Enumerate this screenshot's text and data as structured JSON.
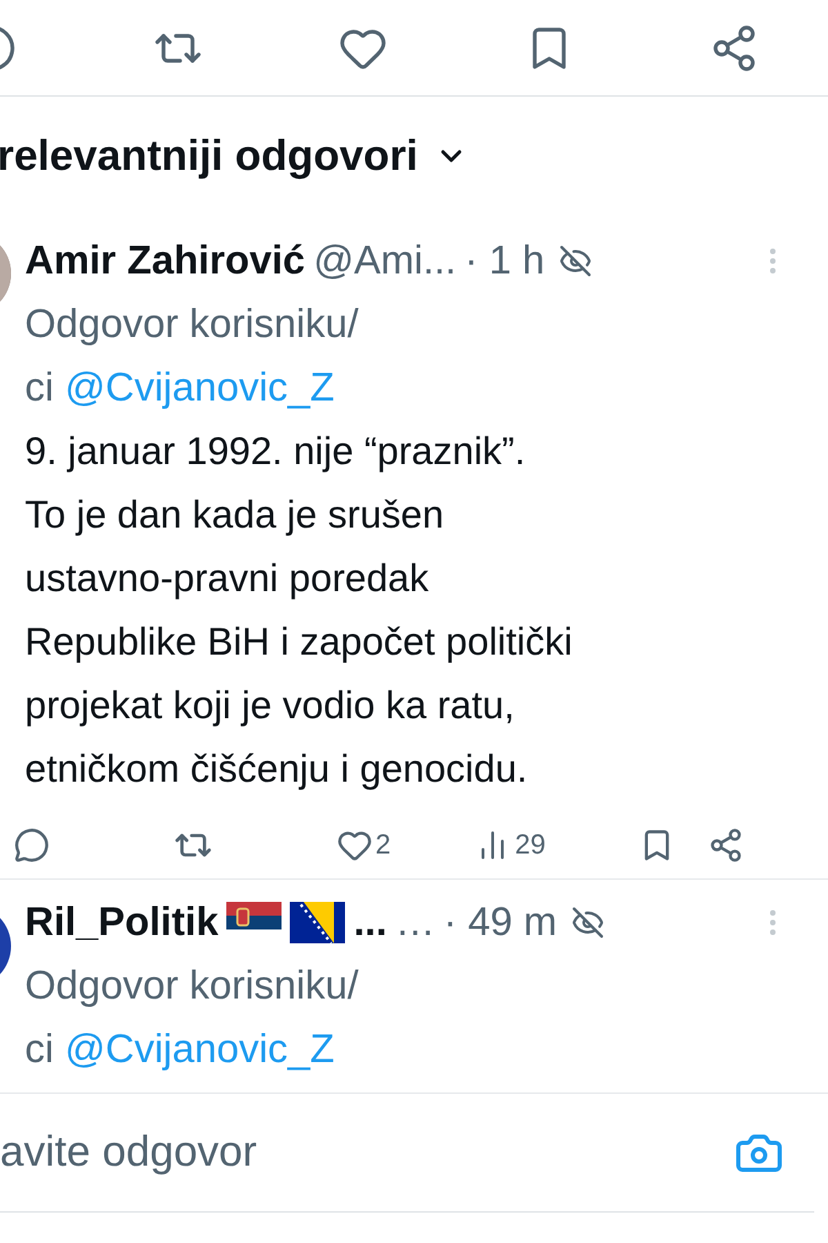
{
  "sort": {
    "label": "relevantniji odgovori"
  },
  "replies": [
    {
      "name": "Amir Zahirović",
      "handle": "@Ami...",
      "time": "· 1 h",
      "reply_prefix": "Odgovor korisniku/",
      "reply_prefix_cont": "ci",
      "mention": "@Cvijanovic_Z",
      "body": [
        "9. januar 1992. nije “praznik”.",
        "To je dan kada je srušen",
        "ustavno-pravni poredak",
        "Republike BiH i započet politički",
        "projekat koji je vodio ka ratu,",
        "etničkom čišćenju i genocidu."
      ],
      "stats": {
        "likes": "2",
        "views": "29"
      }
    },
    {
      "avatar": {
        "kind": "circle",
        "color": "#1d3fa8"
      },
      "name": "Ril_Politik",
      "flags": [
        {
          "kind": "serbia"
        },
        {
          "kind": "bosnia"
        }
      ],
      "name_ellipsis": "...",
      "handle": "…",
      "time": "· 49 m",
      "reply_prefix": "Odgovor korisniku/",
      "reply_prefix_cont": "ci",
      "mention": "@Cvijanovic_Z"
    }
  ],
  "compose": {
    "placeholder": "avite odgovor"
  }
}
